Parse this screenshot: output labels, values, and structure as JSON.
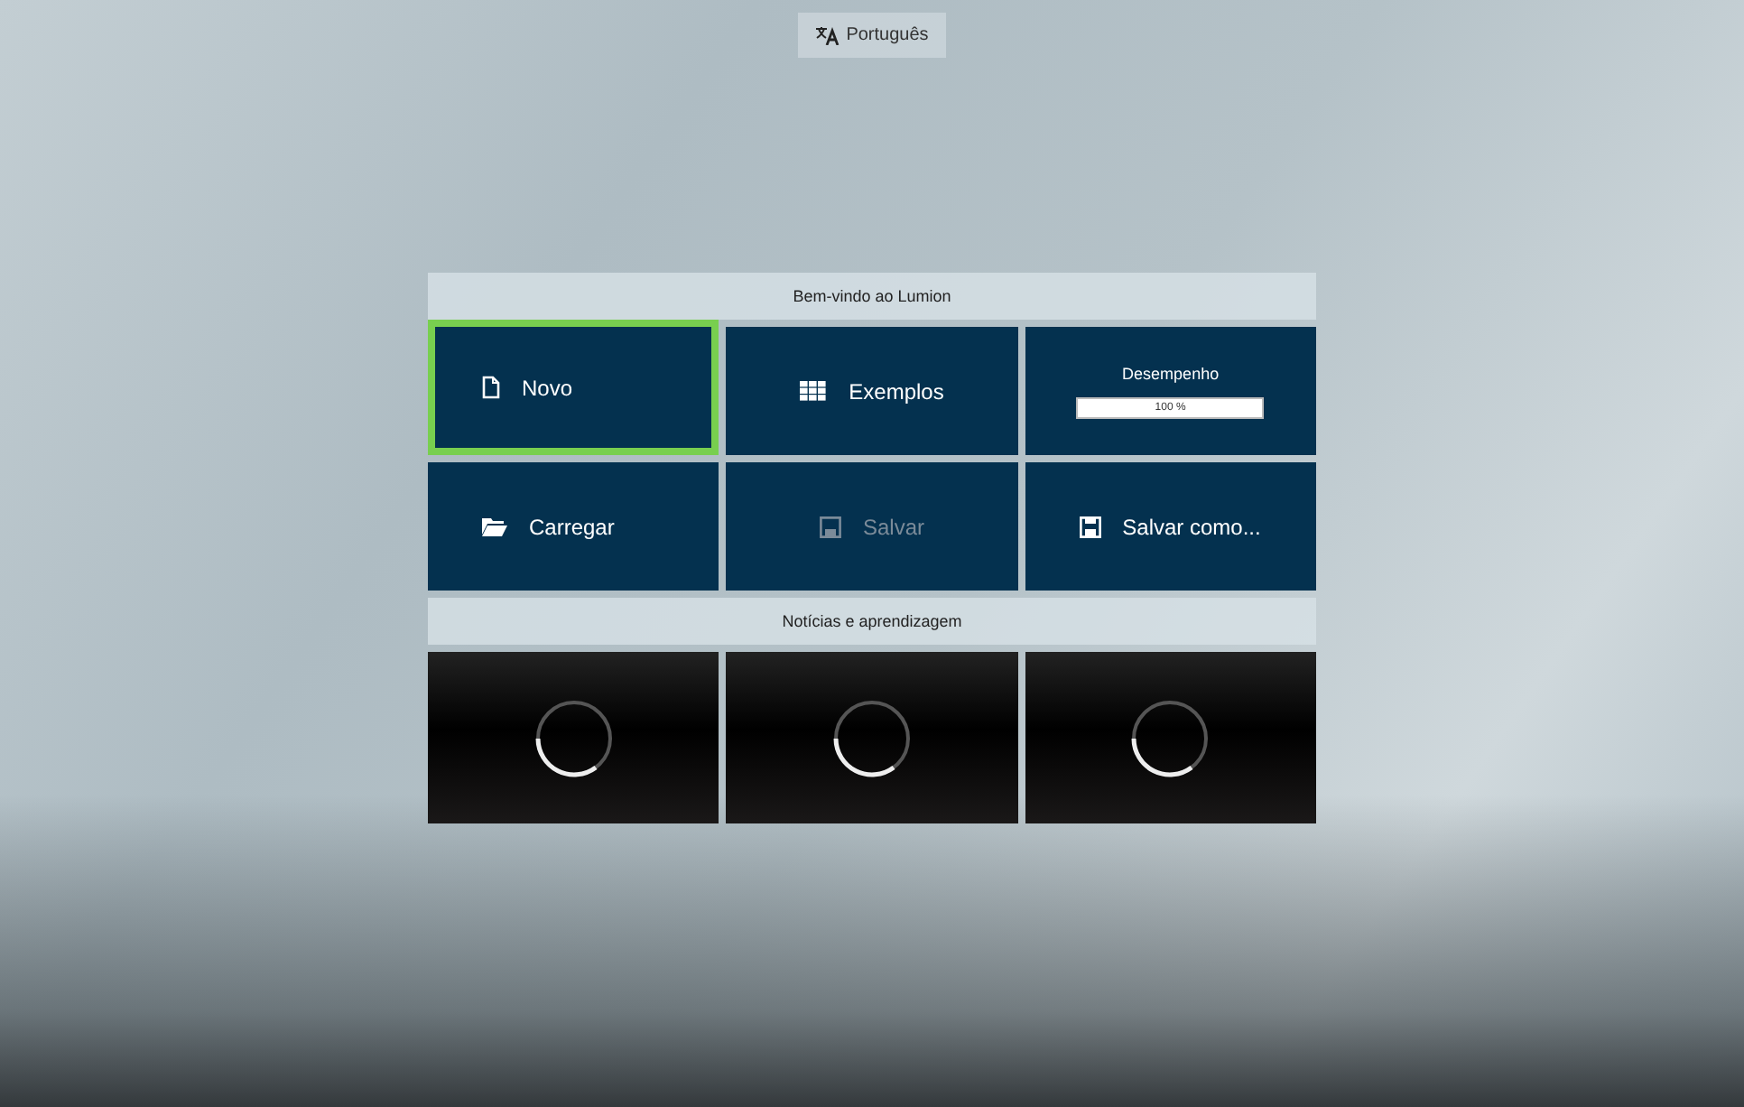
{
  "language_button": {
    "label": "Português"
  },
  "welcome": {
    "title": "Bem-vindo ao Lumion",
    "tiles": [
      {
        "kind": "action",
        "label": "Novo",
        "selected": true,
        "disabled": false
      },
      {
        "kind": "action",
        "label": "Exemplos",
        "selected": false,
        "disabled": false
      },
      {
        "kind": "performance",
        "label": "Desempenho",
        "level": 1,
        "reading": "100 %",
        "selected": false
      },
      {
        "kind": "action",
        "label": "Carregar",
        "selected": false,
        "disabled": false
      },
      {
        "kind": "action",
        "label": "Salvar",
        "selected": false,
        "disabled": true
      },
      {
        "kind": "action",
        "label": "Salvar como...",
        "selected": false,
        "disabled": false
      }
    ]
  },
  "news": {
    "title": "Notícias e aprendizagem",
    "items": [
      {
        "kind": "loading"
      },
      {
        "kind": "loading"
      },
      {
        "kind": "loading"
      }
    ]
  }
}
